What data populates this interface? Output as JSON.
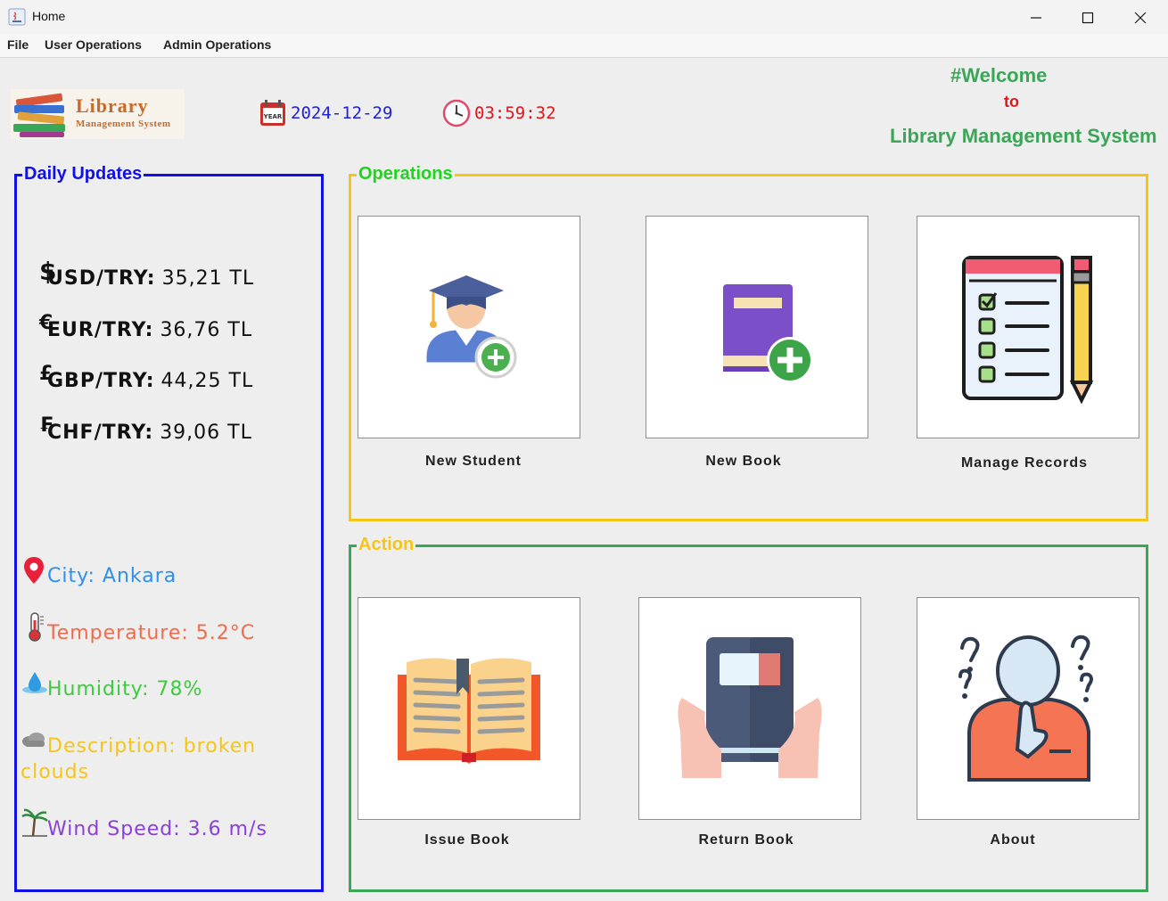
{
  "window": {
    "title": "Home"
  },
  "menu": {
    "items": [
      "File",
      "User Operations",
      "Admin Operations"
    ]
  },
  "header": {
    "logo": {
      "line1": "Library",
      "line2": "Management System"
    },
    "date": "2024-12-29",
    "date_icon_text": "YEAR",
    "time": "03:59:32",
    "welcome_line1": "#Welcome",
    "welcome_line2": "to",
    "welcome_line3": "Library Management System"
  },
  "daily_updates": {
    "title": "Daily Updates",
    "rates": [
      {
        "symbol": "$",
        "label": "USD/TRY:",
        "value": "35,21 TL"
      },
      {
        "symbol": "€",
        "label": "EUR/TRY:",
        "value": "36,76 TL"
      },
      {
        "symbol": "£",
        "label": "GBP/TRY:",
        "value": "44,25 TL"
      },
      {
        "symbol": "₣",
        "label": "CHF/TRY:",
        "value": "39,06 TL"
      }
    ],
    "weather": {
      "city": "City: Ankara",
      "temperature": "Temperature: 5.2°C",
      "humidity": "Humidity: 78%",
      "description_line1": "Description: broken",
      "description_line2": "clouds",
      "wind": "Wind Speed: 3.6 m/s"
    }
  },
  "operations": {
    "title": "Operations",
    "tiles": [
      {
        "label": "New Student",
        "icon": "student-add-icon"
      },
      {
        "label": "New Book",
        "icon": "book-add-icon"
      },
      {
        "label": "Manage Records",
        "icon": "checklist-icon"
      }
    ]
  },
  "action": {
    "title": "Action",
    "tiles": [
      {
        "label": "Issue Book",
        "icon": "open-book-icon"
      },
      {
        "label": "Return Book",
        "icon": "hands-book-icon"
      },
      {
        "label": "About",
        "icon": "thinking-person-icon"
      }
    ]
  },
  "colors": {
    "daily_border": "#1010e6",
    "operations_border": "#f5c518",
    "action_border": "#3aa657",
    "date": "#1f21d6",
    "time": "#e0151c",
    "city": "#2f8ff0",
    "temperature": "#f06b4b",
    "humidity": "#3ec93e",
    "description": "#f5c518",
    "wind": "#8a3fd8"
  }
}
